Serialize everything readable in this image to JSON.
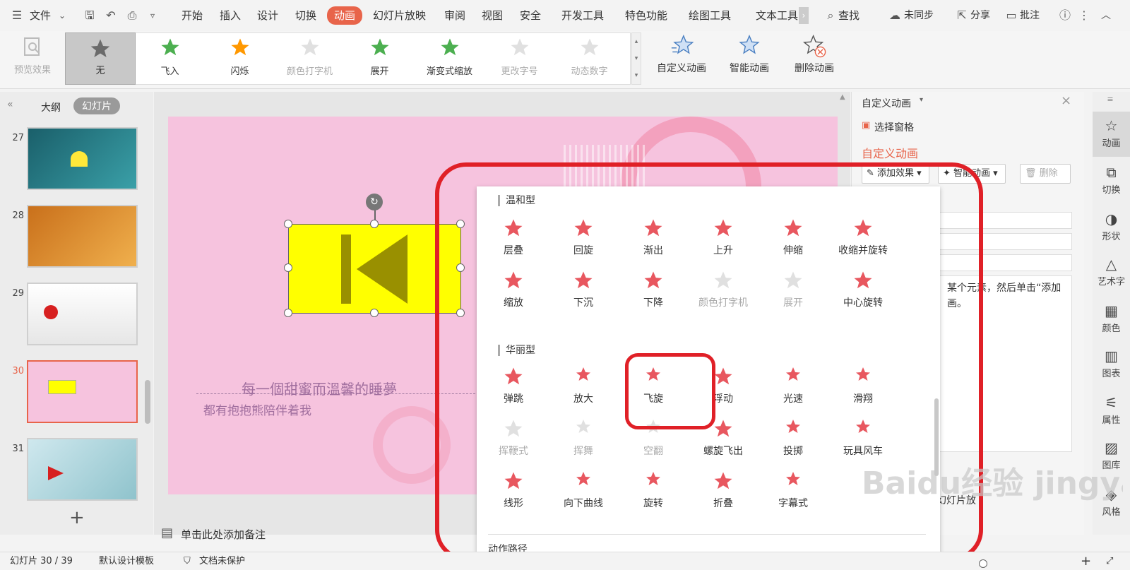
{
  "menubar": {
    "file_label": "文件",
    "tabs": [
      "开始",
      "插入",
      "设计",
      "切换",
      "动画",
      "幻灯片放映",
      "审阅",
      "视图",
      "安全",
      "开发工具",
      "特色功能",
      "绘图工具",
      "文本工具"
    ],
    "search_label": "查找",
    "sync_label": "未同步",
    "share_label": "分享",
    "comment_label": "批注"
  },
  "ribbon": {
    "preview_label": "预览效果",
    "effects": [
      "无",
      "飞入",
      "闪烁",
      "颜色打字机",
      "展开",
      "渐变式缩放",
      "更改字号",
      "动态数字"
    ],
    "custom_anim_label": "自定义动画",
    "smart_anim_label": "智能动画",
    "delete_anim_label": "删除动画"
  },
  "leftpanel": {
    "tab_outline": "大纲",
    "tab_slides": "幻灯片",
    "slide_numbers": [
      "27",
      "28",
      "29",
      "30",
      "31"
    ],
    "add_label": "+"
  },
  "slide": {
    "text_line1": "每一個甜蜜而溫馨的睡夢",
    "text_line2": "都有抱抱熊陪伴着我",
    "notes_placeholder": "单击此处添加备注"
  },
  "dropdown": {
    "group1": "温和型",
    "group1_items": [
      "层叠",
      "回旋",
      "渐出",
      "上升",
      "伸缩",
      "收缩并旋转",
      "缩放",
      "下沉",
      "下降",
      "颜色打字机",
      "展开",
      "中心旋转"
    ],
    "group2": "华丽型",
    "group2_items": [
      "弹跳",
      "放大",
      "飞旋",
      "浮动",
      "光速",
      "滑翔",
      "挥鞭式",
      "挥舞",
      "空翻",
      "螺旋飞出",
      "投掷",
      "玩具风车",
      "线形",
      "向下曲线",
      "旋转",
      "折叠",
      "字幕式"
    ],
    "group3": "动作路径"
  },
  "rightpane": {
    "title": "自定义动画",
    "select_pane": "选择窗格",
    "section_title": "自定义动画",
    "add_effect": "添加效果",
    "smart_anim": "智能动画",
    "delete": "删除",
    "hint": "某个元素，然后单击“添加画。",
    "play_label": "幻灯片放"
  },
  "sidetools": [
    "动画",
    "切换",
    "形状",
    "艺术字",
    "颜色",
    "图表",
    "属性",
    "图库",
    "风格"
  ],
  "statusbar": {
    "slide_info": "幻灯片 30 / 39",
    "template": "默认设计模板",
    "protect": "文档未保护"
  },
  "watermark": "Baidu经验 jingyan.baidu.com",
  "colors": {
    "accent": "#e8644a",
    "highlight_red": "#e02027",
    "star": "#e8575f",
    "slide_bg": "#f6c3de"
  }
}
